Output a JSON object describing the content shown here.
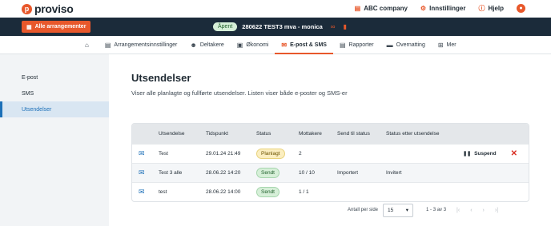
{
  "brand": {
    "name": "proviso",
    "mark": "p"
  },
  "top_links": [
    {
      "label": "ABC company",
      "icon": "building-icon"
    },
    {
      "label": "Innstillinger",
      "icon": "gear-icon"
    },
    {
      "label": "Hjelp",
      "icon": "help-icon"
    }
  ],
  "darkbar": {
    "all_events_label": "Alle arrangementer",
    "status": "Åpent",
    "event_name": "280622 TEST3 mva - monica"
  },
  "nav": [
    {
      "label": "",
      "icon": "home-icon"
    },
    {
      "label": "Arrangementsinnstillinger",
      "icon": "calendar-settings-icon"
    },
    {
      "label": "Deltakere",
      "icon": "people-icon"
    },
    {
      "label": "Økonomi",
      "icon": "wallet-icon"
    },
    {
      "label": "E-post & SMS",
      "icon": "mail-icon",
      "active": true
    },
    {
      "label": "Rapporter",
      "icon": "report-icon"
    },
    {
      "label": "Overnatting",
      "icon": "bed-icon"
    },
    {
      "label": "Mer",
      "icon": "grid-icon"
    }
  ],
  "sidebar": {
    "items": [
      {
        "label": "E-post"
      },
      {
        "label": "SMS"
      },
      {
        "label": "Utsendelser",
        "active": true
      }
    ]
  },
  "page": {
    "title": "Utsendelser",
    "subtitle": "Viser alle planlagte og fullførte utsendelser. Listen viser både e-poster og SMS-er"
  },
  "table": {
    "headers": [
      "Utsendelse",
      "Tidspunkt",
      "Status",
      "Mottakere",
      "Send til status",
      "Status etter utsendelse"
    ],
    "rows": [
      {
        "name": "Test",
        "time": "29.01.24 21:49",
        "status": "Planlagt",
        "recipients": "2",
        "send_to": "",
        "after": "",
        "action": "Suspend"
      },
      {
        "name": "Test 3 alle",
        "time": "28.06.22 14:20",
        "status": "Sendt",
        "recipients": "10 / 10",
        "send_to": "Importert",
        "after": "Invitert",
        "action": ""
      },
      {
        "name": "test",
        "time": "28.06.22 14:00",
        "status": "Sendt",
        "recipients": "1 / 1",
        "send_to": "",
        "after": "",
        "action": ""
      }
    ]
  },
  "pager": {
    "per_page_label": "Antall per side",
    "per_page_value": "15",
    "range": "1 - 3 av 3"
  },
  "colors": {
    "accent": "#e8582b",
    "dark": "#1b2b3a",
    "link": "#1d70b8"
  }
}
